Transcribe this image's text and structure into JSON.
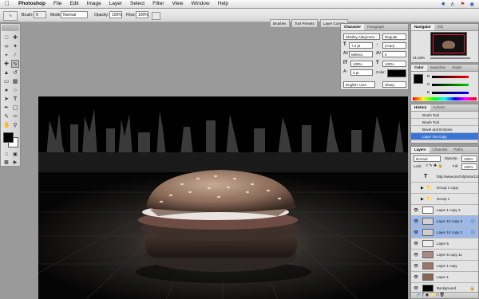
{
  "menubar": {
    "apple": "",
    "app_name": "Photoshop",
    "items": [
      "File",
      "Edit",
      "Image",
      "Layer",
      "Select",
      "Filter",
      "View",
      "Window",
      "Help"
    ]
  },
  "options": {
    "brush_label": "Brush:",
    "brush_size": "9",
    "mode_label": "Mode:",
    "mode_value": "Normal",
    "opacity_label": "Opacity:",
    "opacity_value": "100%",
    "flow_label": "Flow:",
    "flow_value": "100%",
    "well_tabs": [
      "Brushes",
      "Tool Presets",
      "Layer Comps"
    ]
  },
  "character": {
    "tabs": [
      "Character",
      "Paragraph"
    ],
    "font_family": "Shelley AllegroScr...",
    "font_style": "Regular",
    "font_size": "7.2 pt",
    "leading": "(Auto)",
    "kerning": "Metrics",
    "tracking": "0",
    "vscale": "100%",
    "hscale": "100%",
    "baseline": "0 pt",
    "color_label": "Color:",
    "language": "English: USA",
    "antialias": "Sharp"
  },
  "navigator": {
    "tabs": [
      "Navigator",
      "Info"
    ],
    "zoom": "31.53%"
  },
  "color_palette": {
    "tabs": [
      "Color",
      "Swatches",
      "Styles"
    ],
    "channels": [
      {
        "label": "R",
        "value": ""
      },
      {
        "label": "G",
        "value": ""
      },
      {
        "label": "B",
        "value": ""
      }
    ]
  },
  "history": {
    "tabs": [
      "History",
      "Actions"
    ],
    "items": [
      "Brush Tool",
      "Brush Tool",
      "Bevel and Emboss",
      "Layer Via Copy"
    ]
  },
  "layers": {
    "tabs": [
      "Layers",
      "Channels",
      "Paths"
    ],
    "blend": "Normal",
    "opacity_label": "Opacity:",
    "opacity": "100%",
    "lock_label": "Lock:",
    "fill_label": "Fill:",
    "fill": "100%",
    "rows": [
      {
        "name": "http://www.anchi/photo/1235...",
        "kind": "text"
      },
      {
        "name": "Group 1 copy",
        "kind": "group"
      },
      {
        "name": "Group 1",
        "kind": "group"
      },
      {
        "name": "Layer 1 copy 3",
        "kind": "layer"
      },
      {
        "name": "Layer 10 copy 3",
        "kind": "layer"
      },
      {
        "name": "Layer 10 copy 2",
        "kind": "layer"
      },
      {
        "name": "Layer 5",
        "kind": "layer"
      },
      {
        "name": "Layer 5 copy 11",
        "kind": "layer"
      },
      {
        "name": "Layer 1 copy",
        "kind": "layer"
      },
      {
        "name": "Layer 1",
        "kind": "layer"
      },
      {
        "name": "Background",
        "kind": "layer"
      }
    ]
  },
  "colors": {
    "accent": "#3875d7",
    "selection": "#9bb8e6",
    "canvas": "#000000"
  }
}
